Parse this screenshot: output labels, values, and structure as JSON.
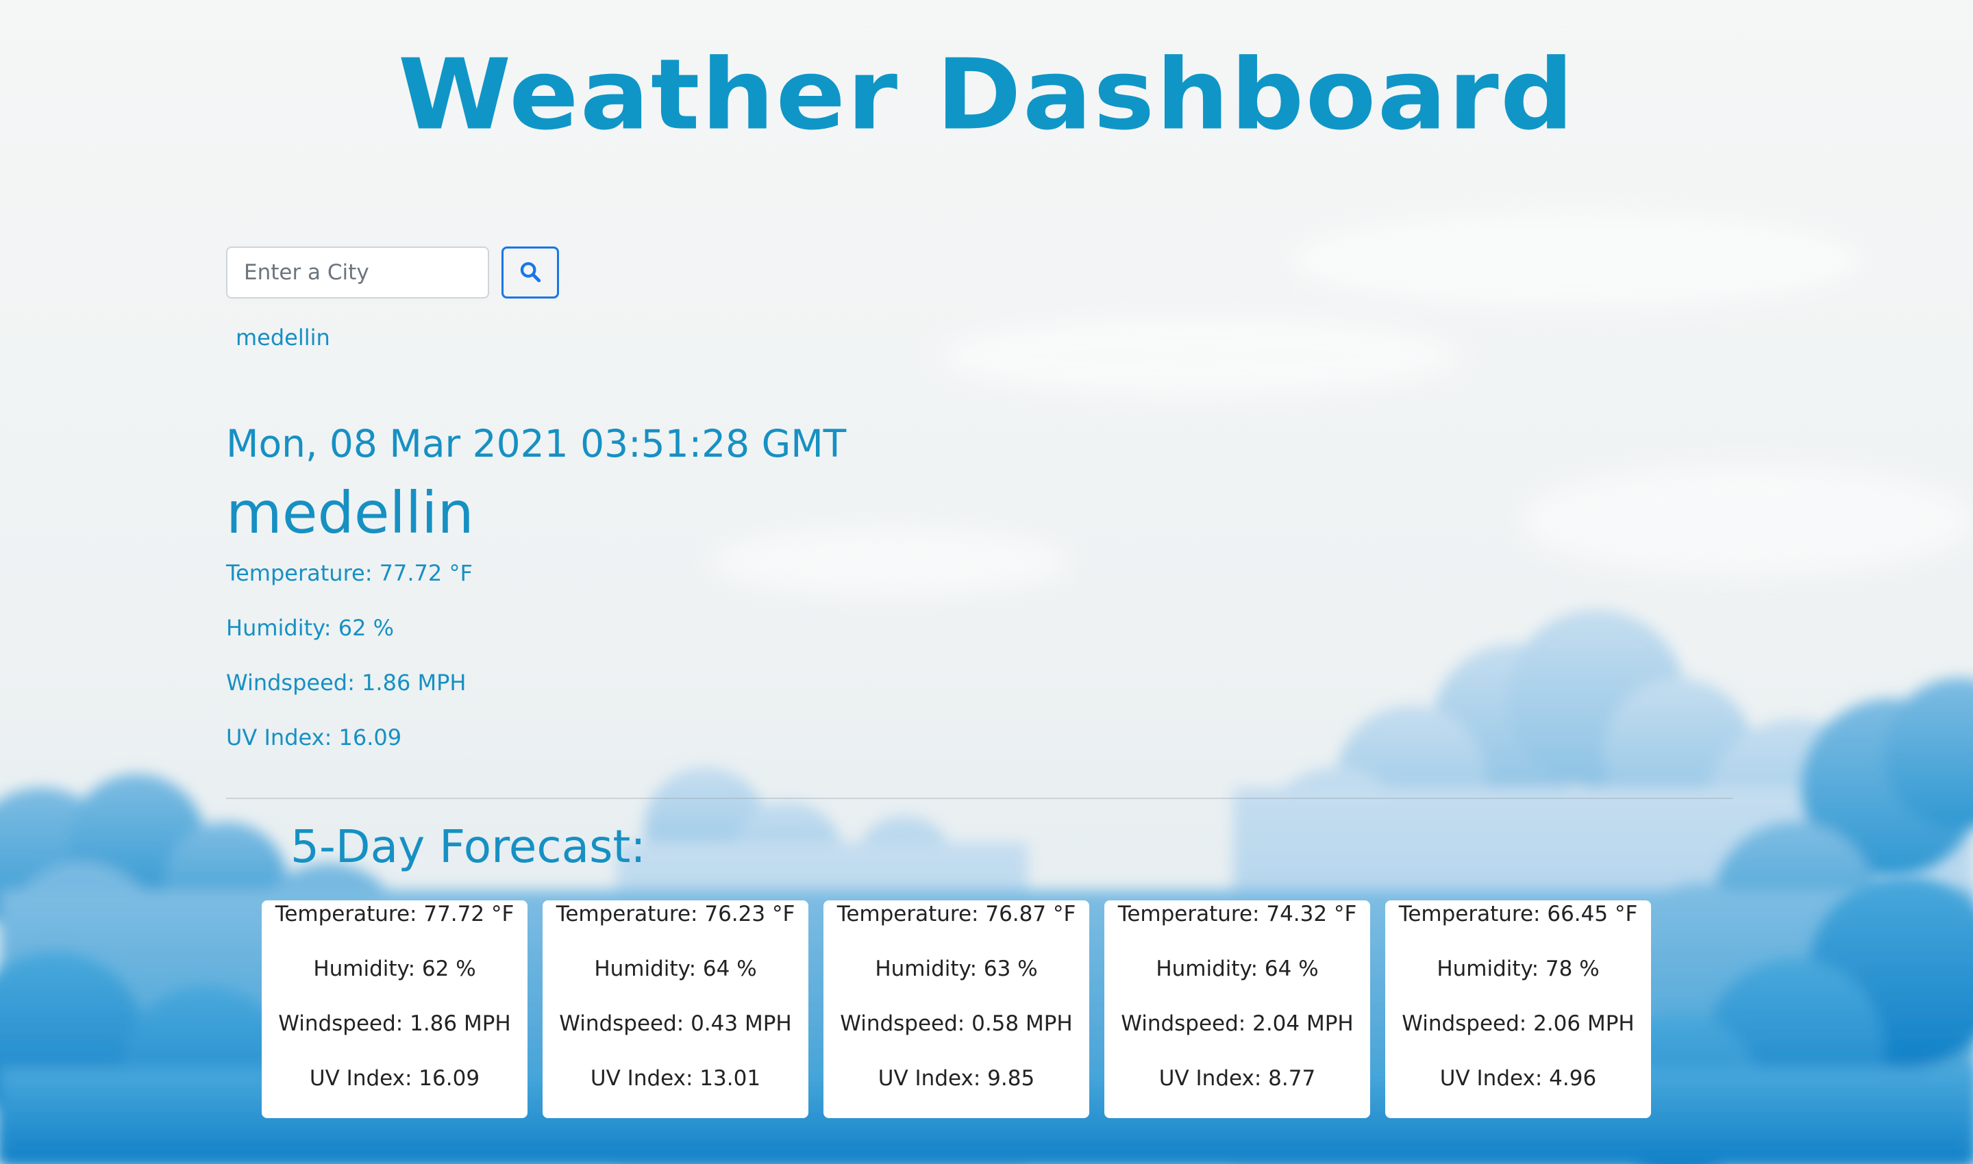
{
  "header": {
    "title": "Weather Dashboard"
  },
  "search": {
    "placeholder": "Enter a City",
    "value": "",
    "button_icon": "search-icon"
  },
  "history": {
    "items": [
      "medellin"
    ]
  },
  "current": {
    "date": "Mon, 08 Mar 2021 03:51:28 GMT",
    "city": "medellin",
    "temperature": "Temperature: 77.72 °F",
    "humidity": "Humidity: 62 %",
    "windspeed": "Windspeed: 1.86 MPH",
    "uv_index": "UV Index: 16.09"
  },
  "forecast": {
    "heading": "5-Day Forecast:",
    "days": [
      {
        "temperature": "Temperature: 77.72 °F",
        "humidity": "Humidity: 62 %",
        "windspeed": "Windspeed: 1.86 MPH",
        "uv_index": "UV Index: 16.09"
      },
      {
        "temperature": "Temperature: 76.23 °F",
        "humidity": "Humidity: 64 %",
        "windspeed": "Windspeed: 0.43 MPH",
        "uv_index": "UV Index: 13.01"
      },
      {
        "temperature": "Temperature: 76.87 °F",
        "humidity": "Humidity: 63 %",
        "windspeed": "Windspeed: 0.58 MPH",
        "uv_index": "UV Index: 9.85"
      },
      {
        "temperature": "Temperature: 74.32 °F",
        "humidity": "Humidity: 64 %",
        "windspeed": "Windspeed: 2.04 MPH",
        "uv_index": "UV Index: 8.77"
      },
      {
        "temperature": "Temperature: 66.45 °F",
        "humidity": "Humidity: 78 %",
        "windspeed": "Windspeed: 2.06 MPH",
        "uv_index": "UV Index: 4.96"
      }
    ]
  },
  "colors": {
    "accent": "#1690c3",
    "title": "#0f96c7",
    "button_border": "#1976e8",
    "sky_light": "#f4f6f6",
    "cloud_blue": "#2f98d2"
  }
}
